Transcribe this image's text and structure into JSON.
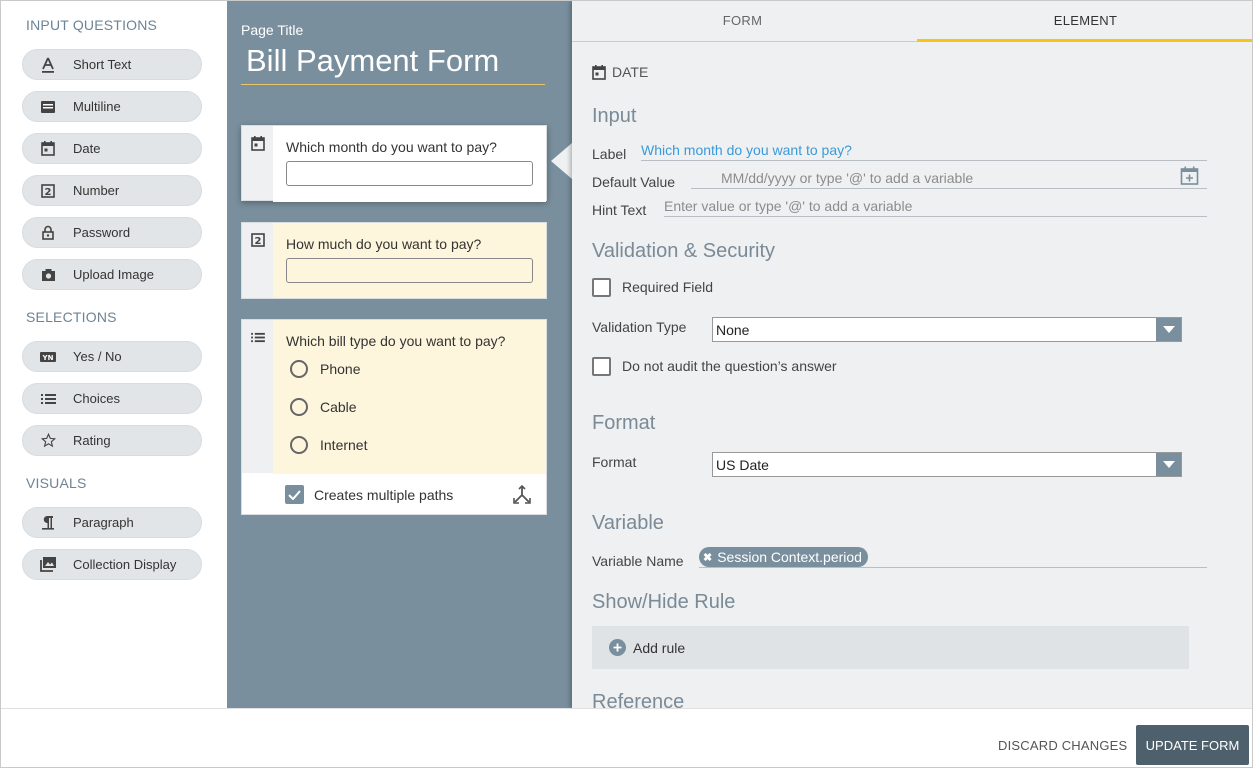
{
  "palette": {
    "input_heading": "INPUT QUESTIONS",
    "input_items": [
      {
        "label": "Short Text",
        "icon": "text-icon"
      },
      {
        "label": "Multiline",
        "icon": "multiline-icon"
      },
      {
        "label": "Date",
        "icon": "calendar-icon"
      },
      {
        "label": "Number",
        "icon": "number-icon"
      },
      {
        "label": "Password",
        "icon": "lock-icon"
      },
      {
        "label": "Upload Image",
        "icon": "camera-icon"
      }
    ],
    "selections_heading": "SELECTIONS",
    "selection_items": [
      {
        "label": "Yes / No",
        "icon": "yes-no-icon"
      },
      {
        "label": "Choices",
        "icon": "list-icon"
      },
      {
        "label": "Rating",
        "icon": "star-icon"
      }
    ],
    "visuals_heading": "VISUALS",
    "visual_items": [
      {
        "label": "Paragraph",
        "icon": "paragraph-icon"
      },
      {
        "label": "Collection Display",
        "icon": "image-gallery-icon"
      }
    ]
  },
  "canvas": {
    "page_title_label": "Page Title",
    "page_title": "Bill Payment Form",
    "questions": [
      {
        "text": "Which month do you want to pay?"
      },
      {
        "text": "How much do you want to pay?"
      },
      {
        "text": "Which bill type do you want to pay?",
        "options": [
          "Phone",
          "Cable",
          "Internet"
        ]
      }
    ],
    "multiple_paths_label": "Creates multiple paths",
    "multiple_paths_checked": true
  },
  "panel": {
    "tabs": [
      "FORM",
      "ELEMENT"
    ],
    "active_tab": "ELEMENT",
    "element_type": "DATE",
    "input_section": "Input",
    "label_label": "Label",
    "label_value": "Which month do you want to pay?",
    "default_value_label": "Default Value",
    "default_value_placeholder": "MM/dd/yyyy or type '@' to add a variable",
    "hint_text_label": "Hint Text",
    "hint_text_placeholder": "Enter value or type '@' to add a variable",
    "validation_section": "Validation & Security",
    "required_field_label": "Required Field",
    "validation_type_label": "Validation Type",
    "validation_type_value": "None",
    "no_audit_label": "Do not audit the question’s answer",
    "format_section": "Format",
    "format_label": "Format",
    "format_value": "US Date",
    "variable_section": "Variable",
    "variable_name_label": "Variable Name",
    "variable_name_value": "Session Context.period",
    "show_hide_section": "Show/Hide Rule",
    "add_rule_label": "Add rule",
    "reference_section": "Reference"
  },
  "footer": {
    "discard_label": "DISCARD CHANGES",
    "update_label": "UPDATE FORM"
  },
  "colors": {
    "canvas_bg": "#798f9d",
    "panel_bg": "#eef0f2",
    "accent_tab": "#f5c518",
    "highlight_card": "#fdf5dc",
    "link_blue": "#3a9ad9",
    "primary_button": "#4f606d"
  }
}
